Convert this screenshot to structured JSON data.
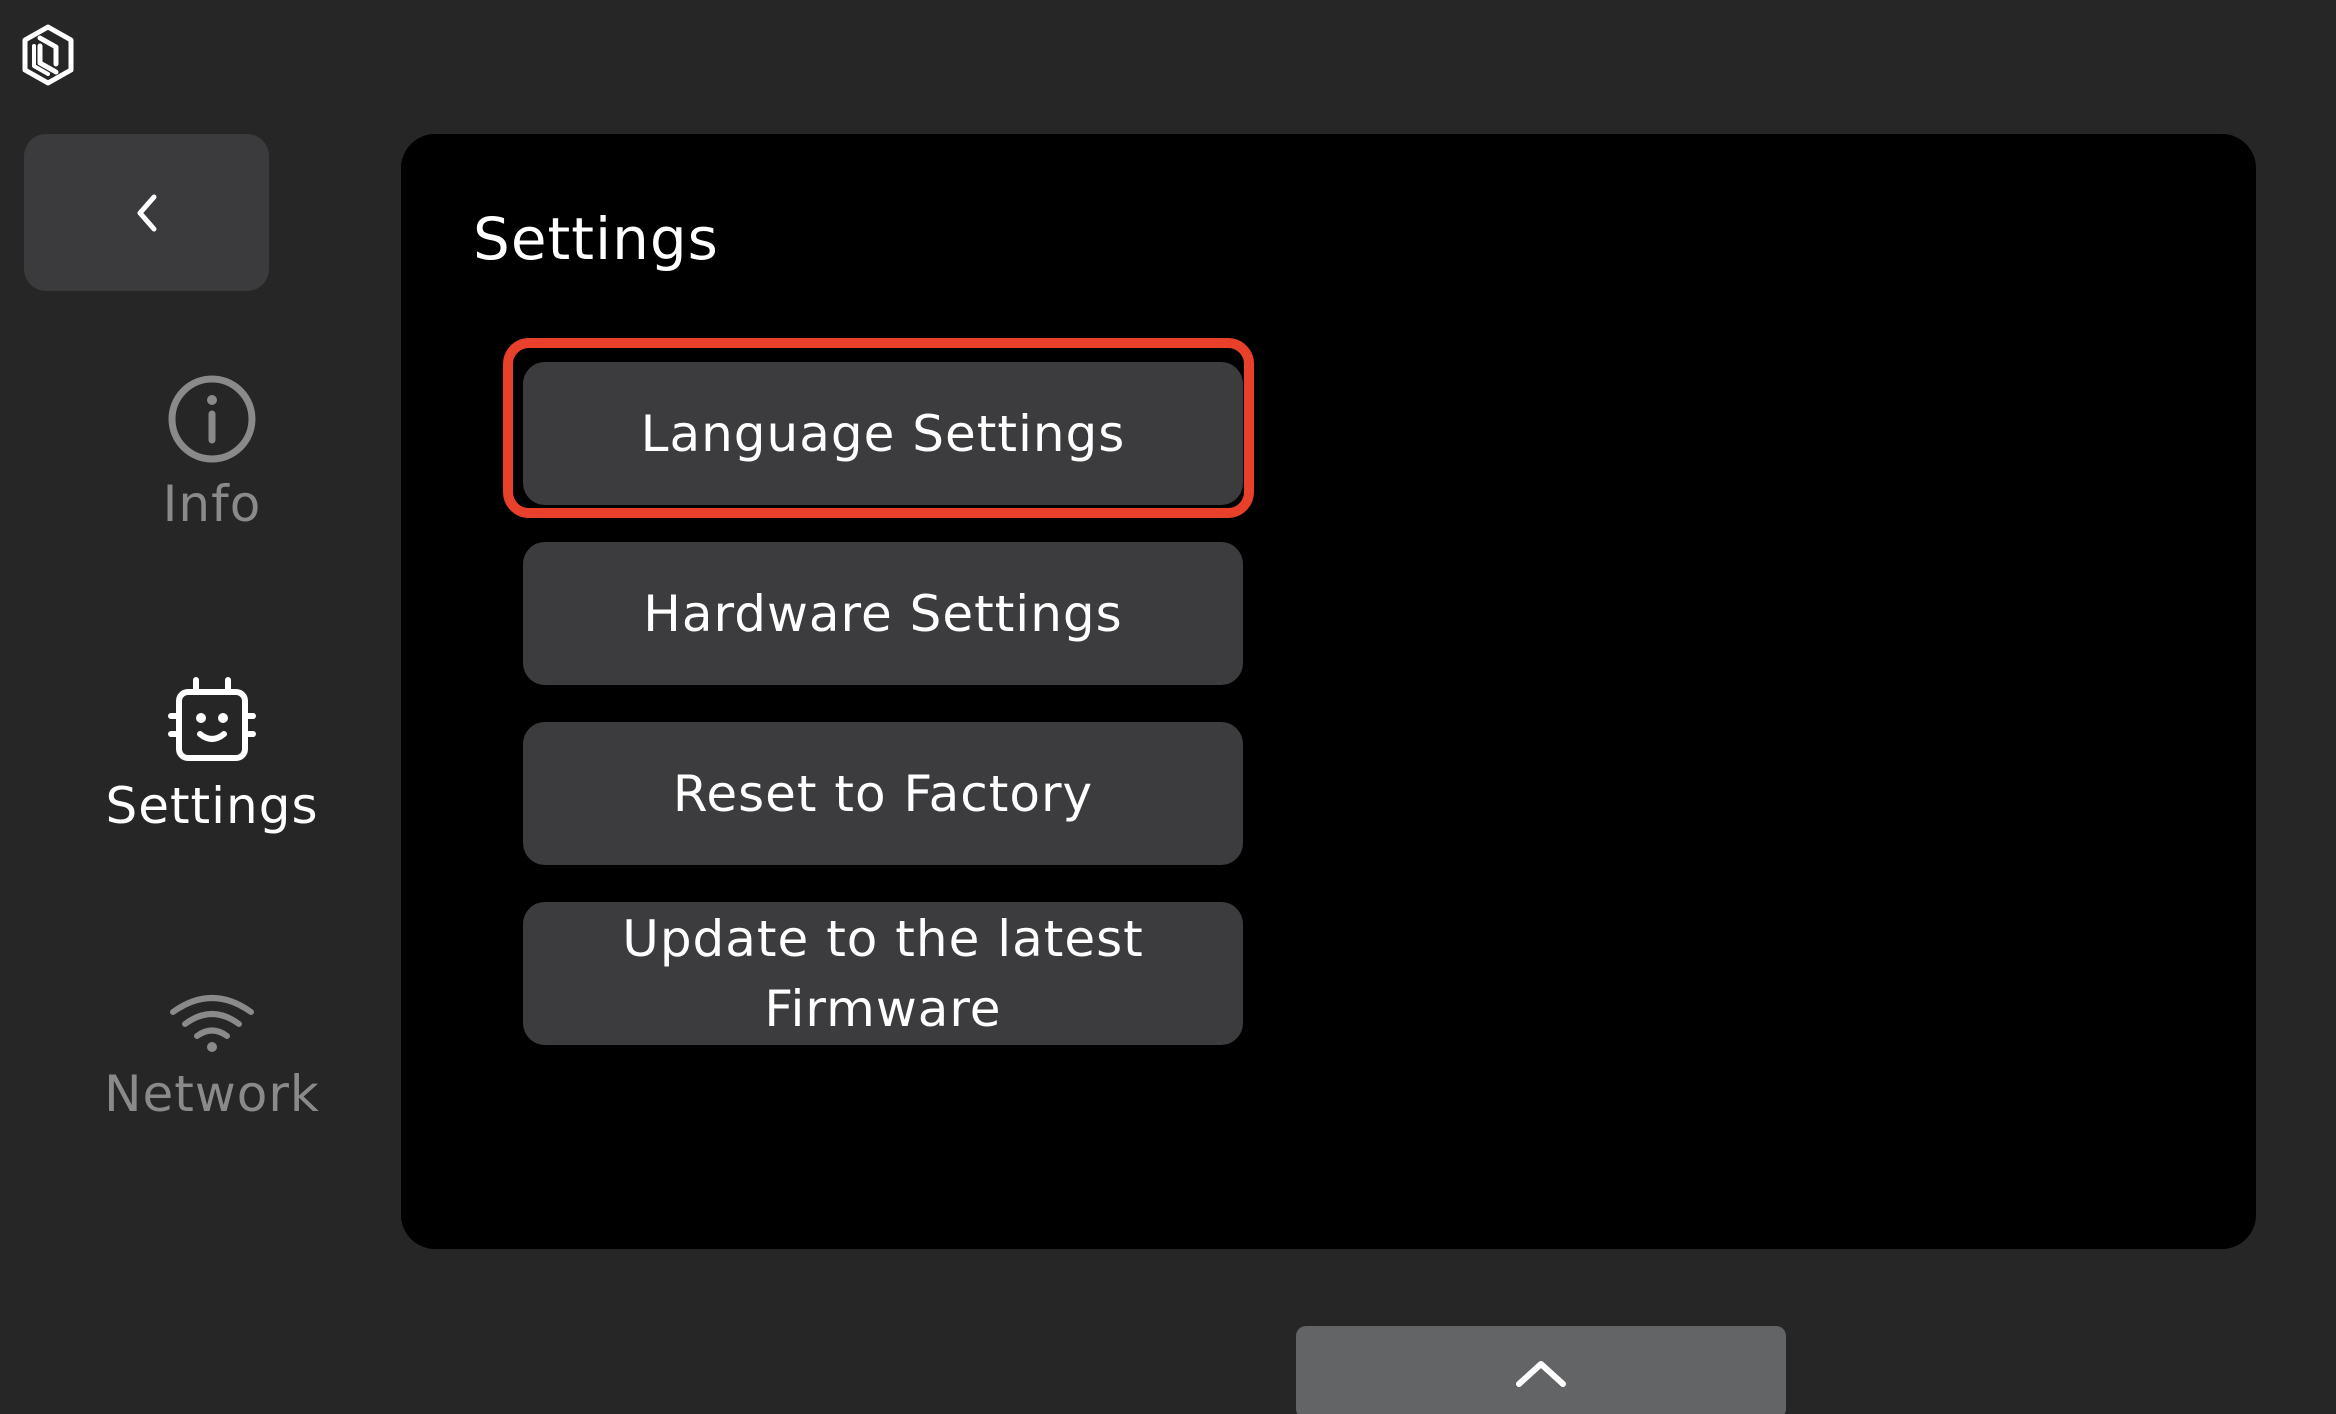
{
  "app": {
    "logo_icon": "brand-logo-icon",
    "back_icon": "chevron-left-icon"
  },
  "sidebar": {
    "items": [
      {
        "label": "Info",
        "icon": "info-icon",
        "active": false
      },
      {
        "label": "Settings",
        "icon": "robot-face-icon",
        "active": true
      },
      {
        "label": "Network",
        "icon": "wifi-icon",
        "active": false
      }
    ]
  },
  "main": {
    "title": "Settings",
    "buttons": [
      {
        "label": "Language Settings",
        "highlighted": true
      },
      {
        "label": "Hardware Settings"
      },
      {
        "label": "Reset to Factory"
      },
      {
        "label": "Update to the latest Firmware"
      }
    ],
    "scroll_icon": "chevron-up-icon"
  },
  "colors": {
    "background": "#262626",
    "panel": "#000000",
    "button": "#3c3c3e",
    "highlight": "#e8402a",
    "inactive_text": "#8a8a8a",
    "active_text": "#ffffff"
  }
}
